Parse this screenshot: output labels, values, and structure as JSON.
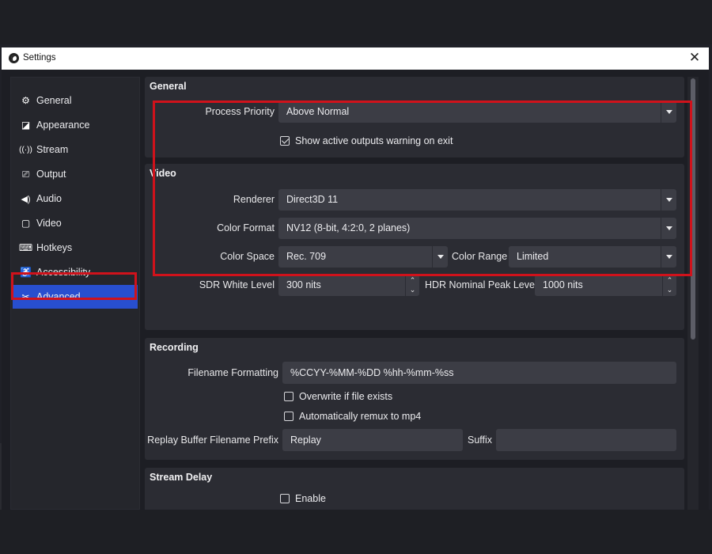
{
  "window": {
    "title": "Settings",
    "close_glyph": "✕"
  },
  "sidebar": {
    "items": [
      {
        "label": "General",
        "icon": "gear-icon",
        "glyph": "⚙"
      },
      {
        "label": "Appearance",
        "icon": "appearance-icon",
        "glyph": "◪"
      },
      {
        "label": "Stream",
        "icon": "antenna-icon",
        "glyph": "📶"
      },
      {
        "label": "Output",
        "icon": "output-icon",
        "glyph": "⎚"
      },
      {
        "label": "Audio",
        "icon": "speaker-icon",
        "glyph": "🔊"
      },
      {
        "label": "Video",
        "icon": "monitor-icon",
        "glyph": "▢"
      },
      {
        "label": "Hotkeys",
        "icon": "keyboard-icon",
        "glyph": "⌨"
      },
      {
        "label": "Accessibility",
        "icon": "accessibility-icon",
        "glyph": "♿"
      },
      {
        "label": "Advanced",
        "icon": "tools-icon",
        "glyph": "✂"
      }
    ],
    "active": "Advanced"
  },
  "general": {
    "title": "General",
    "process_priority_label": "Process Priority",
    "process_priority_value": "Above Normal",
    "show_warning_label": "Show active outputs warning on exit",
    "show_warning_checked": true
  },
  "video": {
    "title": "Video",
    "renderer_label": "Renderer",
    "renderer_value": "Direct3D 11",
    "color_format_label": "Color Format",
    "color_format_value": "NV12 (8-bit, 4:2:0, 2 planes)",
    "color_space_label": "Color Space",
    "color_space_value": "Rec. 709",
    "color_range_label": "Color Range",
    "color_range_value": "Limited",
    "sdr_white_label": "SDR White Level",
    "sdr_white_value": "300 nits",
    "hdr_peak_label": "HDR Nominal Peak Level",
    "hdr_peak_value": "1000 nits"
  },
  "recording": {
    "title": "Recording",
    "filename_label": "Filename Formatting",
    "filename_value": "%CCYY-%MM-%DD %hh-%mm-%ss",
    "overwrite_label": "Overwrite if file exists",
    "overwrite_checked": false,
    "remux_label": "Automatically remux to mp4",
    "remux_checked": false,
    "replay_prefix_label": "Replay Buffer Filename Prefix",
    "replay_prefix_value": "Replay",
    "suffix_label": "Suffix",
    "suffix_value": ""
  },
  "stream_delay": {
    "title": "Stream Delay",
    "enable_label": "Enable",
    "enable_checked": false
  },
  "colors": {
    "accent": "#284fcf",
    "highlight": "#d0121b",
    "panel": "#2b2c33",
    "input": "#3c3d45"
  }
}
